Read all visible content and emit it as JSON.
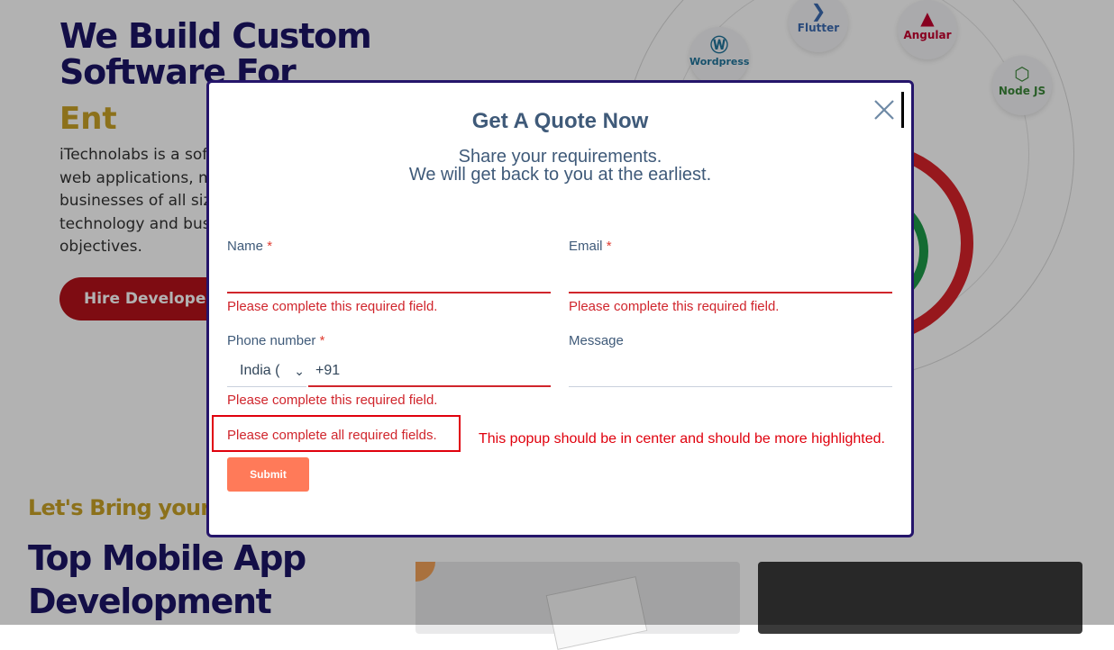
{
  "background": {
    "hero_title": "We Build Custom Software For",
    "hero_word": "Ent",
    "hero_desc": [
      "iTechnolabs is a sof",
      "web applications, m",
      "businesses of all siz",
      "technology and bus",
      "objectives."
    ],
    "hire_button": "Hire Developers",
    "bring_text": "Let's Bring your v",
    "section_title": "Top Mobile App Development",
    "tech_badges": [
      "Flutter",
      "Angular",
      "Wordpress",
      "Node JS"
    ]
  },
  "modal": {
    "title": "Get A Quote Now",
    "subtitle_line1": "Share your requirements.",
    "subtitle_line2": "We will get back to you at the earliest.",
    "required_mark": "*",
    "fields": {
      "name": {
        "label": "Name",
        "value": "",
        "error": "Please complete this required field."
      },
      "email": {
        "label": "Email",
        "value": "",
        "error": "Please complete this required field."
      },
      "phone": {
        "label": "Phone number",
        "country": "India (",
        "value": "+91",
        "error": "Please complete this required field."
      },
      "message": {
        "label": "Message",
        "value": ""
      }
    },
    "summary_error": "Please complete all required fields.",
    "submit_label": "Submit"
  },
  "annotation": "This popup should be in center and should be more highlighted.",
  "colors": {
    "error": "#d0252c",
    "modal_border": "#25156b",
    "submit": "#ff7a59",
    "annotation": "#e0000d"
  }
}
